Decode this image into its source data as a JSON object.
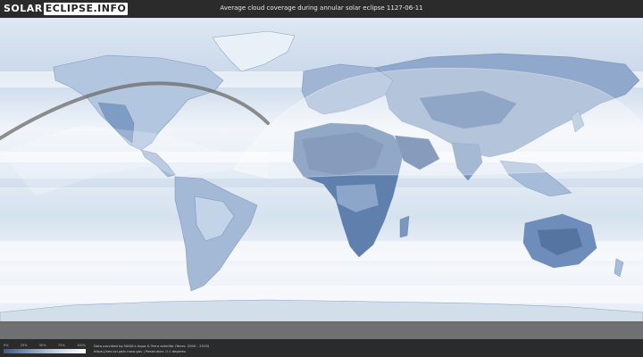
{
  "header": {
    "logo_part1": "SOLAR",
    "logo_part2": "ECLIPSE.INFO",
    "title": "Average cloud coverage during annular solar eclipse 1127-06-11"
  },
  "legend": {
    "ticks": [
      "0%",
      "25%",
      "50%",
      "75%",
      "100%"
    ],
    "colors": [
      "#3b5b8c",
      "#7f9cc2",
      "#c7d6e8",
      "#ffffff"
    ]
  },
  "footer": {
    "credit_line1": "Data provided by NASA's Aqua & Terra satellite (Years: 2000 - 2019)",
    "credit_line2": "https://neo.sci.gsfc.nasa.gov  |  Resolution: 0.1 degrees"
  },
  "map": {
    "ocean_color": "#e6eef7",
    "land_color": "#6f8db8",
    "visibility_overlay": "#ffffff",
    "path_color": "#707070"
  }
}
